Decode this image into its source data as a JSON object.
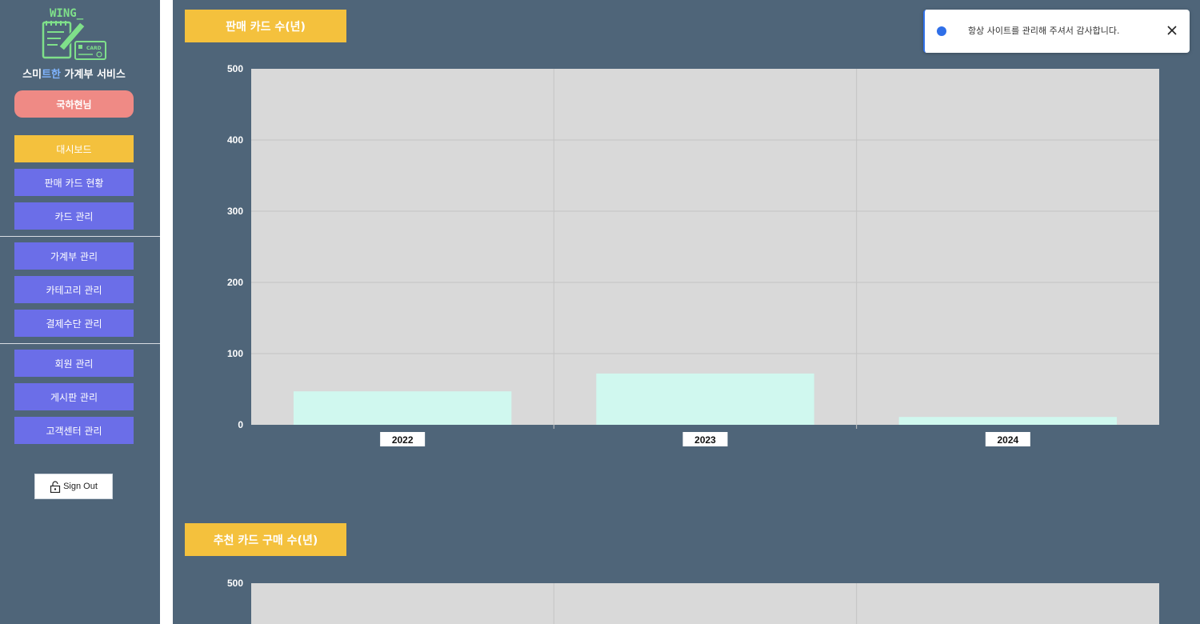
{
  "sidebar": {
    "logo_text": "WING_",
    "logo_card_text": "CARD",
    "brand": {
      "part1": "스미",
      "part2": "트한",
      "part3": " 가계부 서비스"
    },
    "user_label": "국하현님",
    "nav": [
      {
        "label": "대시보드",
        "active": true
      },
      {
        "label": "판매 카드 현황"
      },
      {
        "label": "카드 관리"
      },
      {
        "label": "가계부 관리"
      },
      {
        "label": "카테고리 관리"
      },
      {
        "label": "결제수단 관리"
      },
      {
        "label": "회원 관리"
      },
      {
        "label": "게시판 관리"
      },
      {
        "label": "고객센터 관리"
      }
    ],
    "signout_label": "Sign Out"
  },
  "sections": [
    {
      "title": "판매 카드 수(년)"
    },
    {
      "title": "추천 카드 구매 수(년)"
    }
  ],
  "toast": {
    "message": "항상 사이트를 관리해 주셔서 감사합니다."
  },
  "colors": {
    "accent": "#f4c13d",
    "nav": "#6b6ee8",
    "user": "#ef8a85",
    "background": "#4f6579",
    "bar": "#d0f8ef",
    "plot": "#d9d9d9"
  },
  "chart_data": [
    {
      "type": "bar",
      "categories": [
        "2022",
        "2023",
        "2024"
      ],
      "values": [
        47,
        72,
        11
      ],
      "yticks": [
        "0",
        "100",
        "200",
        "300",
        "400",
        "500"
      ],
      "ylim": [
        0,
        500
      ],
      "grid": true
    },
    {
      "type": "bar",
      "categories": [],
      "values": [],
      "yticks": [
        "500"
      ],
      "ylim": [
        0,
        500
      ],
      "grid": true
    }
  ]
}
